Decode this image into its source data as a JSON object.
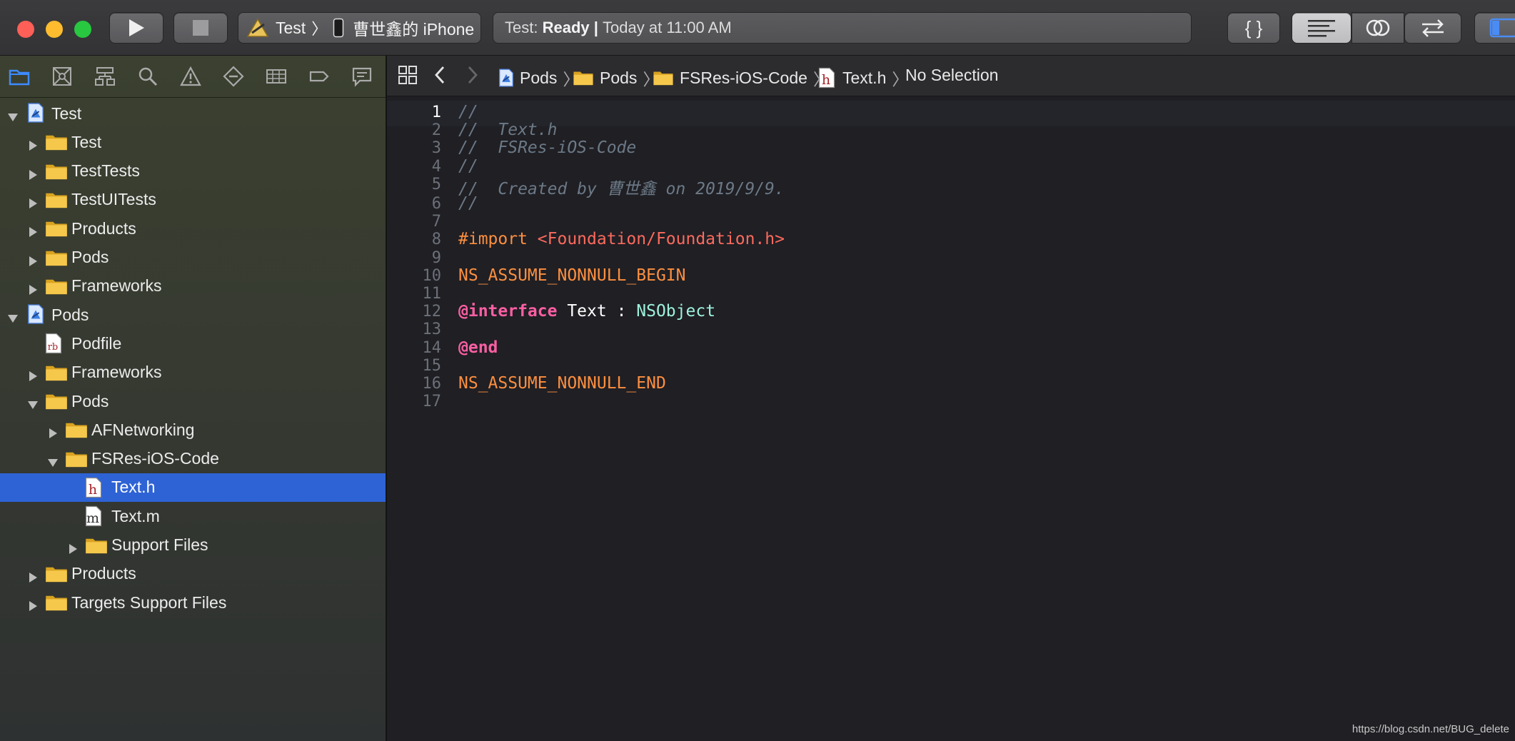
{
  "toolbar": {
    "scheme": {
      "target": "Test",
      "device": "曹世鑫的 iPhone"
    },
    "status": {
      "prefix": "Test:",
      "state": "Ready",
      "separator": "|",
      "time": "Today at 11:00 AM"
    },
    "code_review_label": "{ }"
  },
  "navigator": {
    "tree": [
      {
        "label": "Test",
        "depth": 0,
        "kind": "project",
        "expanded": true
      },
      {
        "label": "Test",
        "depth": 1,
        "kind": "folder",
        "expanded": false
      },
      {
        "label": "TestTests",
        "depth": 1,
        "kind": "folder",
        "expanded": false
      },
      {
        "label": "TestUITests",
        "depth": 1,
        "kind": "folder",
        "expanded": false
      },
      {
        "label": "Products",
        "depth": 1,
        "kind": "folder",
        "expanded": false
      },
      {
        "label": "Pods",
        "depth": 1,
        "kind": "folder",
        "expanded": false
      },
      {
        "label": "Frameworks",
        "depth": 1,
        "kind": "folder",
        "expanded": false
      },
      {
        "label": "Pods",
        "depth": 0,
        "kind": "project",
        "expanded": true
      },
      {
        "label": "Podfile",
        "depth": 1,
        "kind": "rb"
      },
      {
        "label": "Frameworks",
        "depth": 1,
        "kind": "folder",
        "expanded": false
      },
      {
        "label": "Pods",
        "depth": 1,
        "kind": "folder",
        "expanded": true
      },
      {
        "label": "AFNetworking",
        "depth": 2,
        "kind": "folder",
        "expanded": false
      },
      {
        "label": "FSRes-iOS-Code",
        "depth": 2,
        "kind": "folder",
        "expanded": true
      },
      {
        "label": "Text.h",
        "depth": 3,
        "kind": "h",
        "selected": true
      },
      {
        "label": "Text.m",
        "depth": 3,
        "kind": "m"
      },
      {
        "label": "Support Files",
        "depth": 3,
        "kind": "folder",
        "expanded": false
      },
      {
        "label": "Products",
        "depth": 1,
        "kind": "folder",
        "expanded": false
      },
      {
        "label": "Targets Support Files",
        "depth": 1,
        "kind": "folder",
        "expanded": false
      }
    ]
  },
  "jumpbar": {
    "crumbs": [
      {
        "label": "Pods",
        "kind": "project"
      },
      {
        "label": "Pods",
        "kind": "folder"
      },
      {
        "label": "FSRes-iOS-Code",
        "kind": "folder"
      },
      {
        "label": "Text.h",
        "kind": "h"
      },
      {
        "label": "No Selection",
        "kind": "none"
      }
    ]
  },
  "editor": {
    "current_line": 1,
    "lines": [
      {
        "n": "1",
        "text": "//",
        "cls": "cm"
      },
      {
        "n": "2",
        "text": "//  Text.h",
        "cls": "cm"
      },
      {
        "n": "3",
        "text": "//  FSRes-iOS-Code",
        "cls": "cm"
      },
      {
        "n": "4",
        "text": "//",
        "cls": "cm"
      },
      {
        "n": "5",
        "text": "//  Created by 曹世鑫 on 2019/9/9.",
        "cls": "cm"
      },
      {
        "n": "6",
        "text": "//",
        "cls": "cm"
      },
      {
        "n": "7",
        "text": "",
        "cls": "pl"
      },
      {
        "n": "8",
        "parts": [
          {
            "t": "#import ",
            "c": "pp"
          },
          {
            "t": "<Foundation/Foundation.h>",
            "c": "str"
          }
        ]
      },
      {
        "n": "9",
        "text": "",
        "cls": "pl"
      },
      {
        "n": "10",
        "text": "NS_ASSUME_NONNULL_BEGIN",
        "cls": "pp"
      },
      {
        "n": "11",
        "text": "",
        "cls": "pl"
      },
      {
        "n": "12",
        "parts": [
          {
            "t": "@interface",
            "c": "kw"
          },
          {
            "t": " Text : ",
            "c": "pl"
          },
          {
            "t": "NSObject",
            "c": "cls"
          }
        ]
      },
      {
        "n": "13",
        "text": "",
        "cls": "pl"
      },
      {
        "n": "14",
        "text": "@end",
        "cls": "kw"
      },
      {
        "n": "15",
        "text": "",
        "cls": "pl"
      },
      {
        "n": "16",
        "text": "NS_ASSUME_NONNULL_END",
        "cls": "pp"
      },
      {
        "n": "17",
        "text": "",
        "cls": "pl"
      }
    ]
  },
  "watermark": "https://blog.csdn.net/BUG_delete",
  "colors": {
    "selection": "#2e63d5",
    "comment": "#6c7986",
    "preprocessor": "#fd8f3f",
    "string": "#fc6a5d",
    "keyword": "#fc5fa3",
    "class": "#9ef1dd"
  }
}
